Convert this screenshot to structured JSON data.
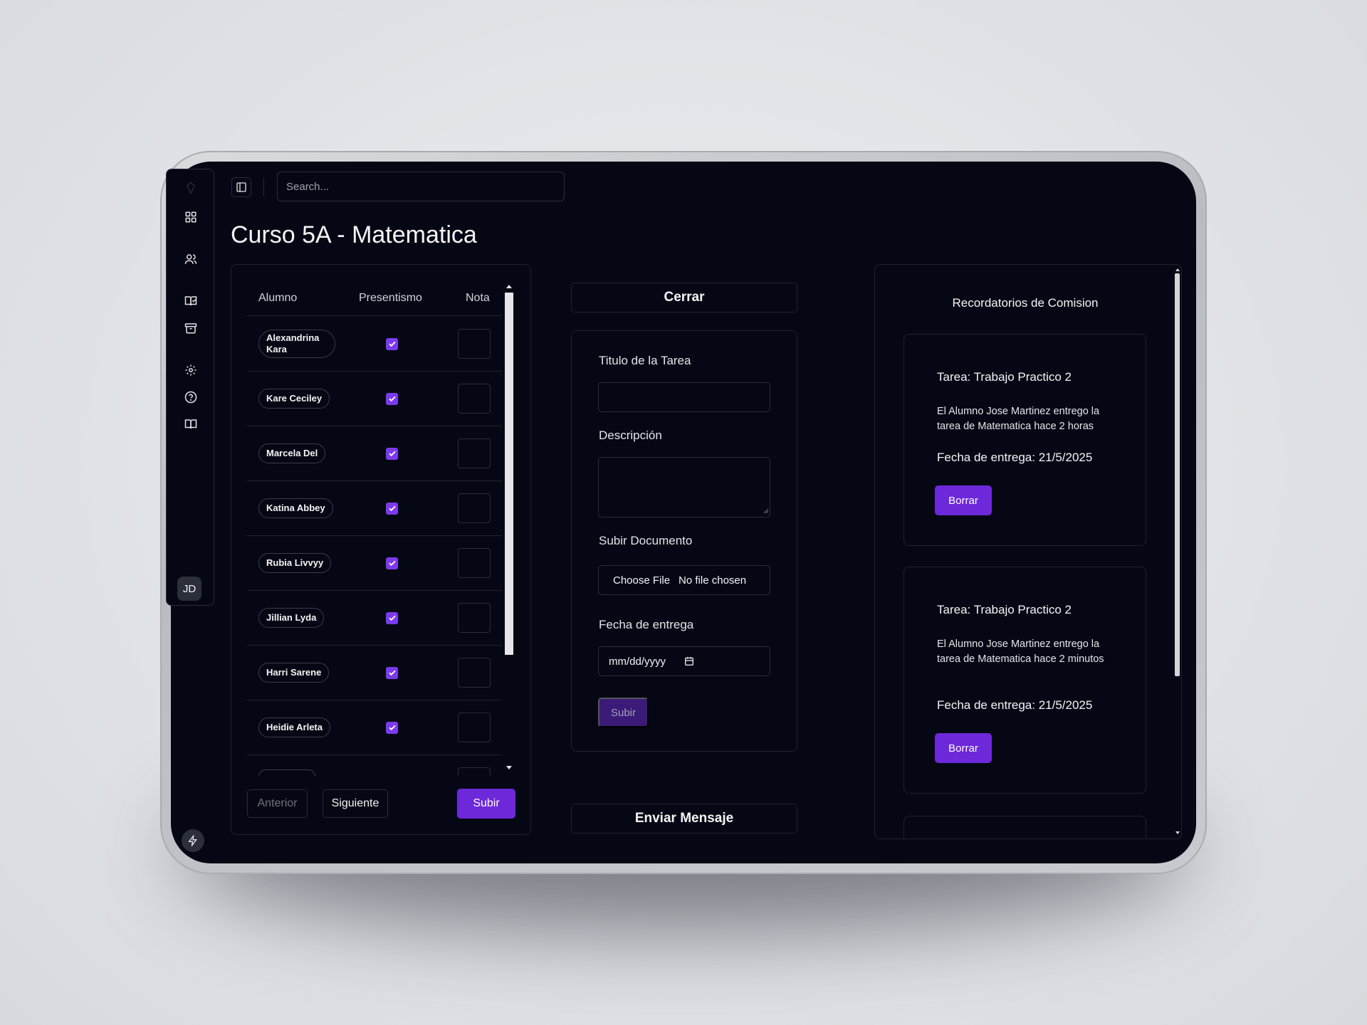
{
  "search": {
    "placeholder": "Search..."
  },
  "page": {
    "title": "Curso 5A - Matematica"
  },
  "sidebar": {
    "icons": [
      "logo-icon",
      "dashboard-icon",
      "users-icon",
      "book-open-check-icon",
      "archive-icon",
      "settings-icon",
      "help-icon",
      "book-icon"
    ],
    "user_initials": "JD"
  },
  "attendance": {
    "headers": {
      "student": "Alumno",
      "presence": "Presentismo",
      "grade": "Nota"
    },
    "rows": [
      {
        "name": "Alexandrina Kara",
        "present": true
      },
      {
        "name": "Kare Ceciley",
        "present": true
      },
      {
        "name": "Marcela Del",
        "present": true
      },
      {
        "name": "Katina Abbey",
        "present": true
      },
      {
        "name": "Rubia Livvyy",
        "present": true
      },
      {
        "name": "Jillian Lyda",
        "present": true
      },
      {
        "name": "Harri Sarene",
        "present": true
      },
      {
        "name": "Heidie Arleta",
        "present": true
      }
    ],
    "prev_label": "Anterior",
    "next_label": "Siguiente",
    "submit_label": "Subir"
  },
  "task_form": {
    "close_label": "Cerrar",
    "title_label": "Titulo de la Tarea",
    "description_label": "Descripción",
    "upload_label": "Subir Documento",
    "choose_file_label": "Choose File",
    "no_file_label": "No file chosen",
    "due_date_label": "Fecha de entrega",
    "date_placeholder": "mm/dd/yyyy",
    "submit_label": "Subir",
    "send_message_label": "Enviar Mensaje"
  },
  "reminders": {
    "title": "Recordatorios de Comision",
    "items": [
      {
        "title": "Tarea: Trabajo Practico 2",
        "body": "El Alumno Jose Martinez entrego la tarea de Matematica hace 2 horas",
        "due": "Fecha de entrega: 21/5/2025",
        "delete_label": "Borrar"
      },
      {
        "title": "Tarea: Trabajo Practico 2",
        "body": "El Alumno Jose Martinez entrego la tarea de Matematica hace 2 minutos",
        "due": "Fecha de entrega: 21/5/2025",
        "delete_label": "Borrar"
      }
    ]
  },
  "colors": {
    "background": "#050814",
    "accent": "#6d28d9",
    "checkbox": "#7c3aed",
    "border": "#2a2d37"
  }
}
